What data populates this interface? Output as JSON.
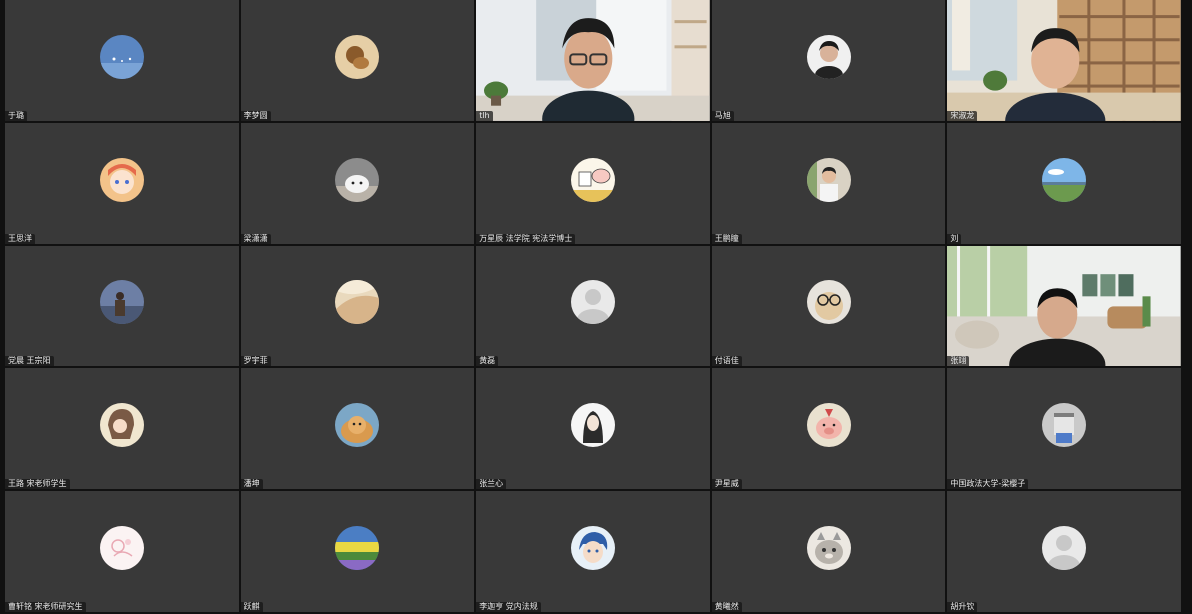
{
  "meeting": {
    "participants": [
      {
        "name": "于璐",
        "avatar": "blue-sky-avatar",
        "type": "avatar"
      },
      {
        "name": "李梦圆",
        "avatar": "brown-drawing-avatar",
        "type": "avatar"
      },
      {
        "name": "tlh",
        "type": "video"
      },
      {
        "name": "马旭",
        "avatar": "person-photo-avatar",
        "type": "avatar"
      },
      {
        "name": "宋淑龙",
        "type": "video"
      },
      {
        "name": "王思洋",
        "avatar": "cartoon-girl-avatar",
        "type": "avatar"
      },
      {
        "name": "梁潇潇",
        "avatar": "white-dog-avatar",
        "type": "avatar"
      },
      {
        "name": "万星辰 法学院 宪法学博士",
        "avatar": "cartoon-pig-avatar",
        "type": "avatar"
      },
      {
        "name": "王鹏瞳",
        "avatar": "person-photo-avatar",
        "type": "avatar"
      },
      {
        "name": "刘",
        "avatar": "landscape-avatar",
        "type": "avatar"
      },
      {
        "name": "党晨 王宗阳",
        "avatar": "sunset-silhouette-avatar",
        "type": "avatar"
      },
      {
        "name": "罗宇菲",
        "avatar": "beige-abstract-avatar",
        "type": "avatar"
      },
      {
        "name": "黄磊",
        "avatar": "default-user-avatar",
        "type": "avatar"
      },
      {
        "name": "付语佳",
        "avatar": "glasses-pet-avatar",
        "type": "avatar"
      },
      {
        "name": "张翊",
        "type": "video"
      },
      {
        "name": "王路 宋老师学生",
        "avatar": "anime-girl-avatar",
        "type": "avatar"
      },
      {
        "name": "潘坤",
        "avatar": "hamster-avatar",
        "type": "avatar"
      },
      {
        "name": "张兰心",
        "avatar": "ink-figure-avatar",
        "type": "avatar"
      },
      {
        "name": "尹星威",
        "avatar": "pink-pig-avatar",
        "type": "avatar"
      },
      {
        "name": "中国政法大学-梁樱子",
        "avatar": "mascot-avatar",
        "type": "avatar"
      },
      {
        "name": "曹轩铭 宋老师研究生",
        "avatar": "pink-drawing-avatar",
        "type": "avatar"
      },
      {
        "name": "跃麒",
        "avatar": "flower-field-avatar",
        "type": "avatar"
      },
      {
        "name": "李迦亨 党内法规",
        "avatar": "anime-boy-avatar",
        "type": "avatar"
      },
      {
        "name": "黄曦然",
        "avatar": "grey-cat-avatar",
        "type": "avatar"
      },
      {
        "name": "胡升钦",
        "avatar": "default-user-avatar",
        "type": "avatar"
      }
    ]
  }
}
